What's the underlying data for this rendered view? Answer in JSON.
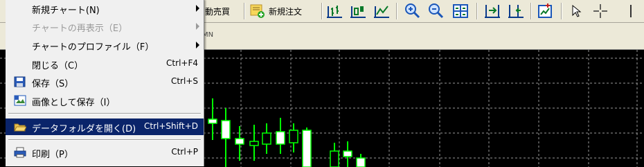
{
  "toolbar": {
    "autotrade_label": "自動売買",
    "autotrade_visible": "動売買",
    "new_order_label": "新規注文"
  },
  "tabrow": {
    "timeframe_label": "MN"
  },
  "menu": {
    "items": [
      {
        "label": "新規チャート(N)",
        "shortcut": "",
        "submenu": true,
        "disabled": false,
        "icon": ""
      },
      {
        "label": "チャートの再表示（E）",
        "shortcut": "",
        "submenu": true,
        "disabled": true,
        "icon": ""
      },
      {
        "label": "チャートのプロファイル（F）",
        "shortcut": "",
        "submenu": true,
        "disabled": false,
        "icon": ""
      },
      {
        "label": "閉じる（C）",
        "shortcut": "Ctrl+F4",
        "submenu": false,
        "disabled": false,
        "icon": ""
      },
      {
        "label": "保存（S）",
        "shortcut": "Ctrl+S",
        "submenu": false,
        "disabled": false,
        "icon": "floppy-disk-icon"
      },
      {
        "label": "画像として保存（I）",
        "shortcut": "",
        "submenu": false,
        "disabled": false,
        "icon": "image-save-icon"
      },
      {
        "label": "データフォルダを開く(D)",
        "shortcut": "Ctrl+Shift+D",
        "submenu": false,
        "disabled": false,
        "selected": true,
        "icon": "folder-open-icon"
      },
      {
        "label": "印刷（P）",
        "shortcut": "Ctrl+P",
        "submenu": false,
        "disabled": false,
        "icon": "printer-icon"
      }
    ]
  },
  "colors": {
    "menu_selected_bg": "#0a246a",
    "chart_bg": "#000000",
    "grid": "#9a9a9a",
    "candle": "#00ff00",
    "toolbar_bg": "#ece9d8"
  }
}
